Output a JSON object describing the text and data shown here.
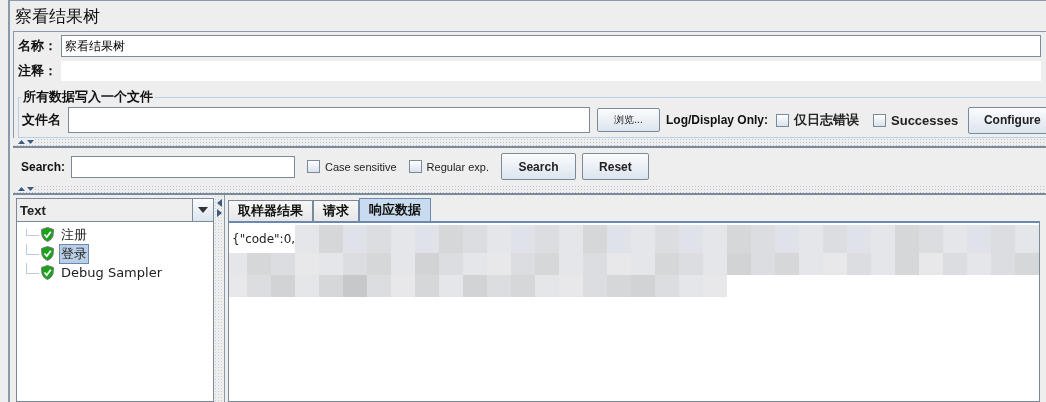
{
  "title": "察看结果树",
  "name_field": {
    "label": "名称：",
    "value": "察看结果树"
  },
  "comment_field": {
    "label": "注释："
  },
  "file_group": {
    "title": "所有数据写入一个文件",
    "file_label": "文件名",
    "browse_button": "浏览...",
    "log_label": "Log/Display Only:",
    "checkboxes": [
      {
        "label": "仅日志错误",
        "checked": false
      },
      {
        "label": "Successes",
        "checked": false
      }
    ],
    "configure_button": "Configure"
  },
  "search_bar": {
    "label": "Search:",
    "options": [
      {
        "label": "Case sensitive",
        "checked": false
      },
      {
        "label": "Regular exp.",
        "checked": false
      }
    ],
    "buttons": [
      "Search",
      "Reset"
    ]
  },
  "renderer_select": {
    "value": "Text"
  },
  "tree": [
    {
      "label": "注册",
      "selected": false
    },
    {
      "label": "登录",
      "selected": true
    },
    {
      "label": "Debug Sampler",
      "selected": false
    }
  ],
  "tabs": [
    {
      "label": "取样器结果",
      "selected": false
    },
    {
      "label": "请求",
      "selected": false
    },
    {
      "label": "响应数据",
      "selected": true
    }
  ],
  "response_text": "{\"code\":0,"
}
